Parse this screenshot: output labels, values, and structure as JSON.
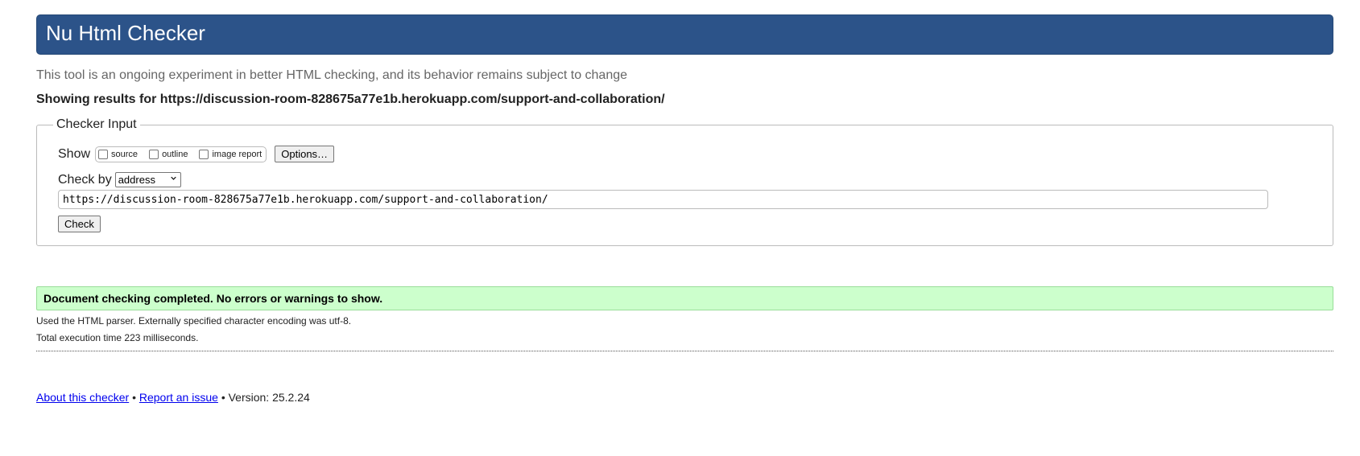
{
  "header": {
    "title": "Nu Html Checker"
  },
  "tagline": "This tool is an ongoing experiment in better HTML checking, and its behavior remains subject to change",
  "results_heading": "Showing results for https://discussion-room-828675a77e1b.herokuapp.com/support-and-collaboration/",
  "checker_input": {
    "legend": "Checker Input",
    "show_label": "Show",
    "show_options": [
      {
        "label": "source",
        "checked": false
      },
      {
        "label": "outline",
        "checked": false
      },
      {
        "label": "image report",
        "checked": false
      }
    ],
    "options_button": "Options…",
    "check_by_label": "Check by",
    "check_by_selected": "address",
    "url_value": "https://discussion-room-828675a77e1b.herokuapp.com/support-and-collaboration/",
    "check_button": "Check"
  },
  "result": {
    "success_message": "Document checking completed. No errors or warnings to show.",
    "parser_info": "Used the HTML parser. Externally specified character encoding was utf-8.",
    "execution_time": "Total execution time 223 milliseconds."
  },
  "footer": {
    "about_link": "About this checker",
    "separator": "•",
    "report_link": "Report an issue",
    "version": "Version: 25.2.24"
  },
  "colors": {
    "header_bg": "#2c5389",
    "success_bg": "#ccffcc",
    "link": "#0000ee"
  }
}
